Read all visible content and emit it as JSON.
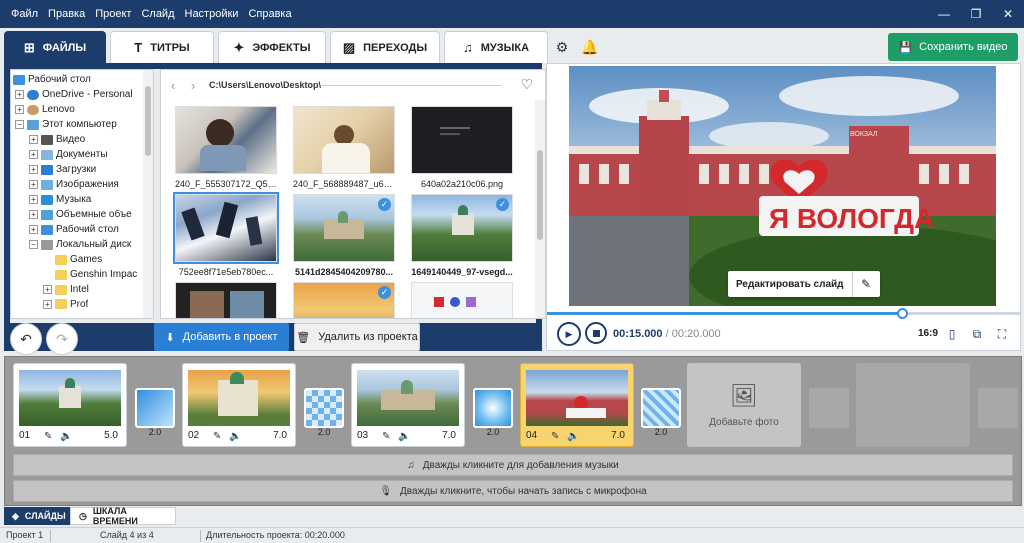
{
  "menu": [
    "Файл",
    "Правка",
    "Проект",
    "Слайд",
    "Настройки",
    "Справка"
  ],
  "tabs": [
    {
      "label": "ФАЙЛЫ",
      "icon": "add-media-icon",
      "active": true
    },
    {
      "label": "ТИТРЫ",
      "icon": "text-t-icon",
      "active": false
    },
    {
      "label": "ЭФФЕКТЫ",
      "icon": "effects-icon",
      "active": false
    },
    {
      "label": "ПЕРЕХОДЫ",
      "icon": "transitions-icon",
      "active": false
    },
    {
      "label": "МУЗЫКА",
      "icon": "music-note-icon",
      "active": false
    }
  ],
  "tree": [
    "Рабочий стол",
    "OneDrive - Personal",
    "Lenovo",
    "Этот компьютер",
    "Видео",
    "Документы",
    "Загрузки",
    "Изображения",
    "Музыка",
    "Объемные объе",
    "Рабочий стол",
    "Локальный диск",
    "Games",
    "Genshin Impac",
    "Intel",
    "Prof"
  ],
  "path": "C:\\Users\\Lenovo\\Desktop\\",
  "files": [
    {
      "name": "240_F_555307172_Q5A8...",
      "selected": false,
      "checked": false
    },
    {
      "name": "240_F_568889487_u6wcr...",
      "selected": false,
      "checked": false
    },
    {
      "name": "640a02a210c06.png",
      "selected": false,
      "checked": false
    },
    {
      "name": "752ee8f71e5eb780ec...",
      "selected": true,
      "checked": false
    },
    {
      "name": "5141d2845404209780...",
      "selected": false,
      "checked": true
    },
    {
      "name": "1649140449_97-vsegd...",
      "selected": false,
      "checked": true
    }
  ],
  "buttons": {
    "add": "Добавить в проект",
    "remove": "Удалить из проекта",
    "save": "Сохранить видео"
  },
  "preview": {
    "edit_label": "Редактировать слайд",
    "sign_text": "ВОКЗАЛ",
    "current_time": "00:15.000",
    "total_time": "00:20.000",
    "time_separator": "/",
    "ratio": "16:9",
    "progress": 0.75
  },
  "slides": [
    {
      "num": "01",
      "dur": "5.0",
      "active": false
    },
    {
      "num": "02",
      "dur": "7.0",
      "active": false
    },
    {
      "num": "03",
      "dur": "7.0",
      "active": false
    },
    {
      "num": "04",
      "dur": "7.0",
      "active": true
    }
  ],
  "transitions": [
    "2.0",
    "2.0",
    "2.0",
    "2.0"
  ],
  "add_photo": "Добавьте фото",
  "music_bar": "Дважды кликните для добавления музыки",
  "mic_bar": "Дважды кликните, чтобы начать запись с микрофона",
  "bottom_tabs": {
    "slides": "СЛАЙДЫ",
    "timeline": "ШКАЛА ВРЕМЕНИ"
  },
  "status": {
    "project": "Проект 1",
    "slide": "Слайд 4 из 4",
    "duration": "Длительность проекта: 00:20.000"
  },
  "colors": {
    "titlebar": "#1c3d6b",
    "accent": "#2a7fd4",
    "save": "#1e9e66",
    "active_slide": "#f7d46d"
  }
}
